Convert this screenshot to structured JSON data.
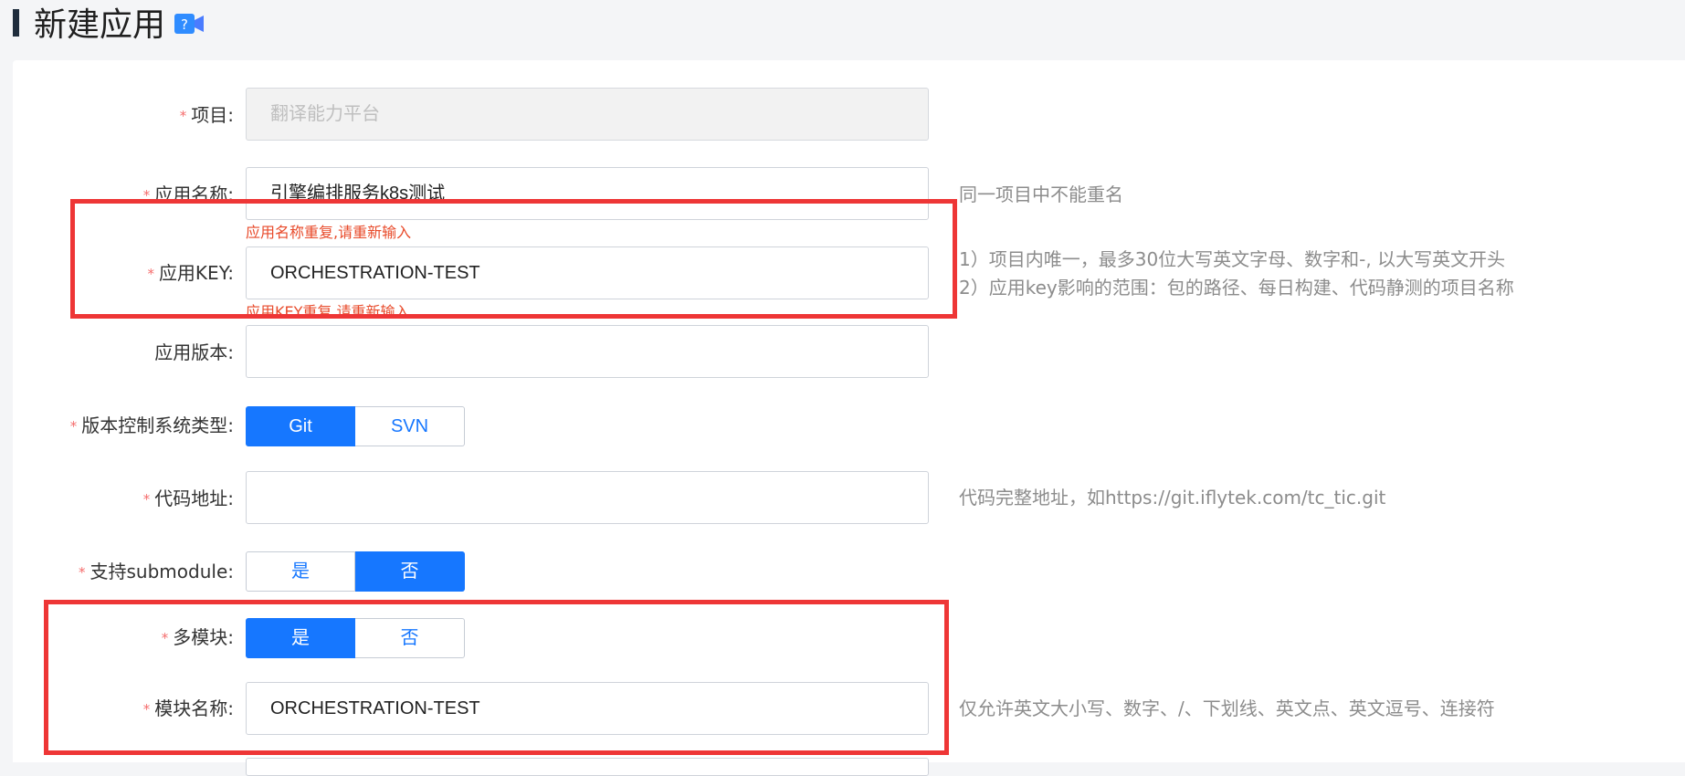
{
  "page": {
    "title": "新建应用"
  },
  "form": {
    "project": {
      "label": "项目:",
      "required": "*",
      "value": "翻译能力平台"
    },
    "app_name": {
      "label": "应用名称:",
      "required": "*",
      "value": "引擎编排服务k8s测试",
      "hint": "同一项目中不能重名",
      "error": "应用名称重复,请重新输入"
    },
    "app_key": {
      "label": "应用KEY:",
      "required": "*",
      "value": "ORCHESTRATION-TEST",
      "hint_line1": "1）项目内唯一，最多30位大写英文字母、数字和-, 以大写英文开头",
      "hint_line2": "2）应用key影响的范围：包的路径、每日构建、代码静测的项目名称",
      "error": "应用KEY重复,请重新输入"
    },
    "app_version": {
      "label": "应用版本:",
      "value": ""
    },
    "vcs_type": {
      "label": "版本控制系统类型:",
      "required": "*",
      "options": [
        "Git",
        "SVN"
      ],
      "selected": "Git"
    },
    "code_url": {
      "label": "代码地址:",
      "required": "*",
      "value": "",
      "hint": "代码完整地址，如https://git.iflytek.com/tc_tic.git"
    },
    "submodule": {
      "label": "支持submodule:",
      "required": "*",
      "options": [
        "是",
        "否"
      ],
      "selected": "否"
    },
    "multi_module": {
      "label": "多模块:",
      "required": "*",
      "options": [
        "是",
        "否"
      ],
      "selected": "是"
    },
    "module_name": {
      "label": "模块名称:",
      "required": "*",
      "value": "ORCHESTRATION-TEST",
      "hint": "仅允许英文大小写、数字、/、下划线、英文点、英文逗号、连接符"
    }
  },
  "colors": {
    "primary": "#1677ff",
    "required_mark": "#f56c6c",
    "error_text": "#e84a2a",
    "annotation_box": "#ee3636"
  }
}
